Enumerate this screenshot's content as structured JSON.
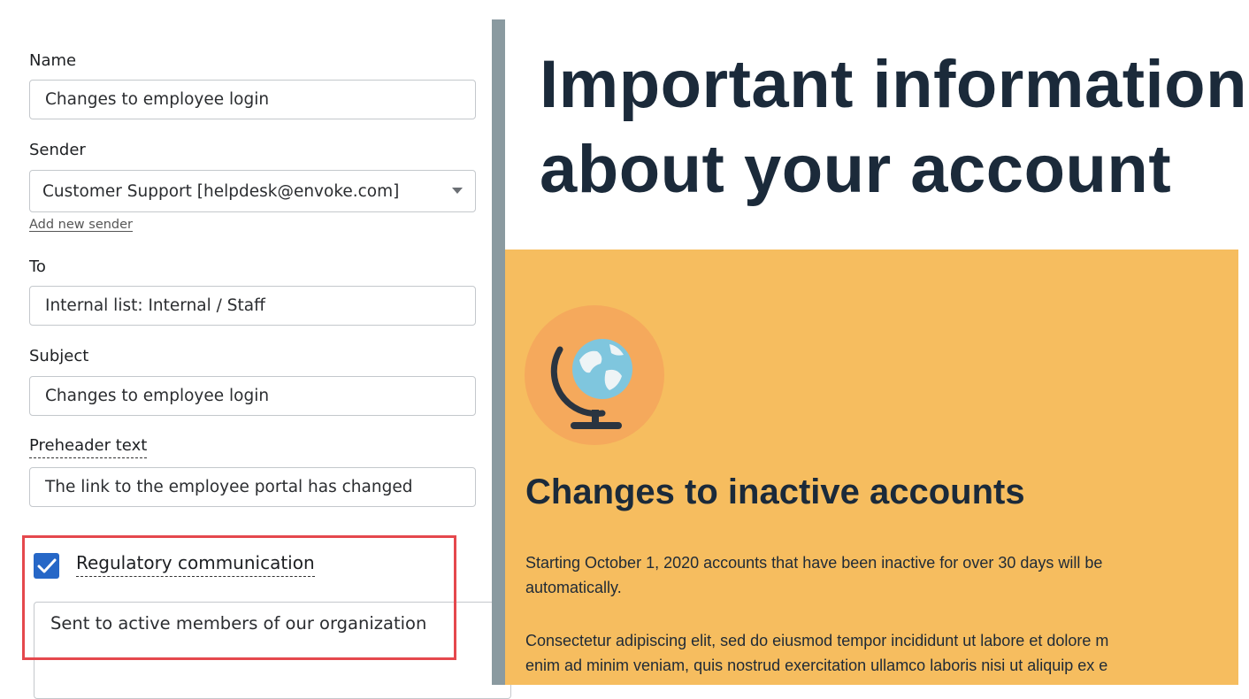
{
  "form": {
    "name_label": "Name",
    "name_value": "Changes to employee login",
    "sender_label": "Sender",
    "sender_value": "Customer Support [helpdesk@envoke.com]",
    "add_sender_link": "Add new sender",
    "to_label": "To",
    "to_value": "Internal list: Internal / Staff",
    "subject_label": "Subject",
    "subject_value": "Changes to employee login",
    "preheader_label": "Preheader text",
    "preheader_value": "The link to the employee portal has changed",
    "regulatory_label": "Regulatory communication",
    "regulatory_checked": true,
    "regulatory_value": "Sent to active members of our organization"
  },
  "preview": {
    "headline_line1": "Important information",
    "headline_line2": "about your account",
    "section_title": "Changes to inactive accounts",
    "para1_line1": "Starting October 1, 2020 accounts that have been inactive for over 30 days will be",
    "para1_line2": "automatically.",
    "para2_line1": "Consectetur adipiscing elit, sed do eiusmod tempor incididunt ut labore et dolore m",
    "para2_line2": "enim ad minim veniam, quis nostrud exercitation ullamco laboris nisi ut aliquip ex e"
  },
  "icons": {
    "globe": "globe-icon",
    "check": "checkmark-icon",
    "caret": "chevron-down-icon"
  },
  "colors": {
    "accent_blue": "#2667c7",
    "highlight_red": "#e5484d",
    "preview_orange": "#f6bd5f",
    "headline_navy": "#1b2a3a",
    "divider_gray": "#8a9aa0"
  }
}
